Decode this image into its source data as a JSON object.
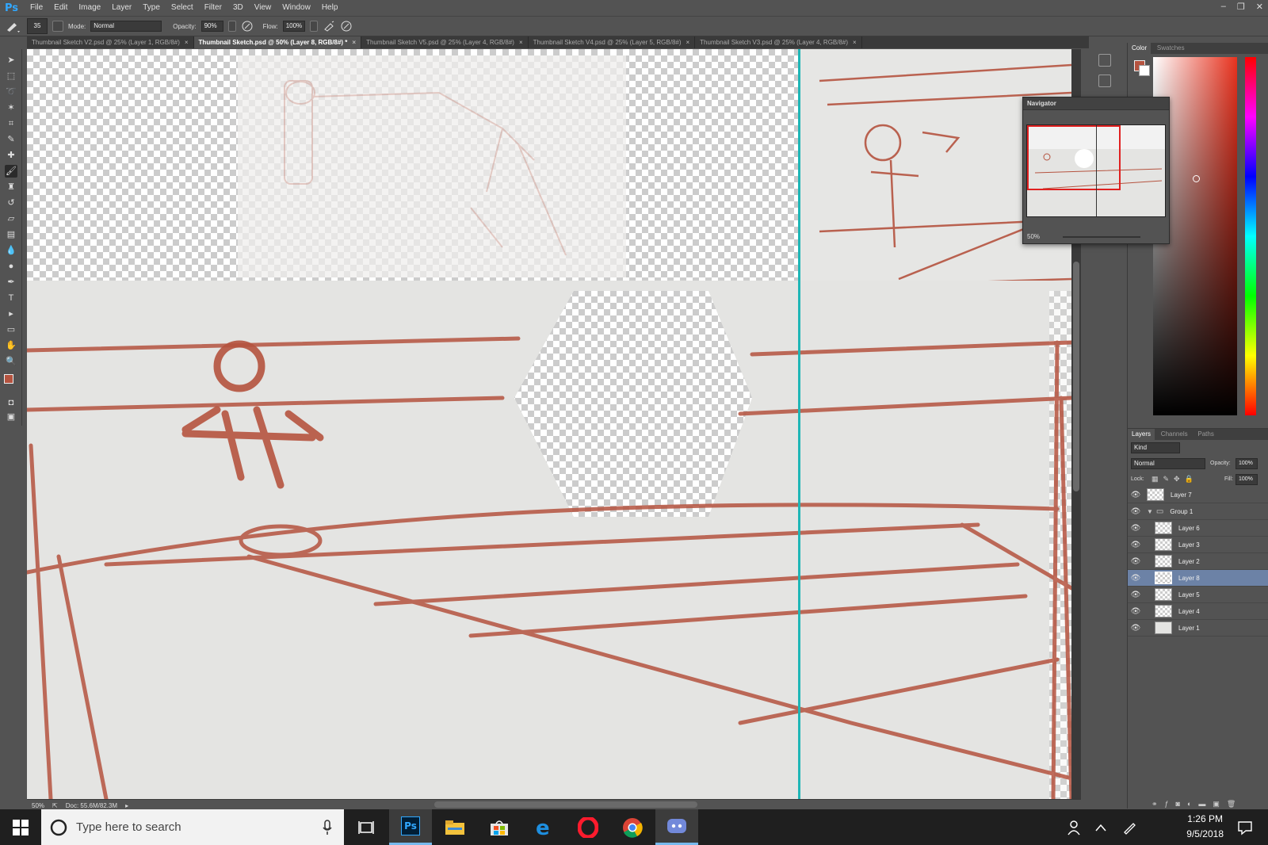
{
  "app": {
    "logo": "Ps"
  },
  "menu": [
    "File",
    "Edit",
    "Image",
    "Layer",
    "Type",
    "Select",
    "Filter",
    "3D",
    "View",
    "Window",
    "Help"
  ],
  "window_controls": {
    "minimize": "–",
    "restore": "❐",
    "close": "✕"
  },
  "options": {
    "brush_size": "35",
    "mode_label": "Mode:",
    "mode_value": "Normal",
    "opacity_label": "Opacity:",
    "opacity_value": "90%",
    "flow_label": "Flow:",
    "flow_value": "100%"
  },
  "tabs": [
    {
      "label": "Thumbnail Sketch V2.psd @ 25% (Layer 1, RGB/8#)",
      "active": false
    },
    {
      "label": "Thumbnail Sketch.psd @ 50% (Layer 8, RGB/8#) *",
      "active": true
    },
    {
      "label": "Thumbnail Sketch V5.psd @ 25% (Layer 4, RGB/8#)",
      "active": false
    },
    {
      "label": "Thumbnail Sketch V4.psd @ 25% (Layer 5, RGB/8#)",
      "active": false
    },
    {
      "label": "Thumbnail Sketch V3.psd @ 25% (Layer 4, RGB/8#)",
      "active": false
    }
  ],
  "tab_close": "×",
  "status": {
    "zoom": "50%",
    "doc": "Doc: 55.6M/82.3M"
  },
  "navigator": {
    "title": "Navigator",
    "zoom": "50%"
  },
  "color_panel": {
    "tabs": [
      "Color",
      "Swatches"
    ],
    "foreground": "#b5533f",
    "background": "#ffffff"
  },
  "layers_panel": {
    "tabs": [
      "Layers",
      "Channels",
      "Paths"
    ],
    "filter": "Kind",
    "blend_mode": "Normal",
    "opacity_label": "Opacity:",
    "opacity_value": "100%",
    "lock_label": "Lock:",
    "fill_label": "Fill:",
    "fill_value": "100%",
    "layers": [
      {
        "name": "Layer 7",
        "selected": false
      },
      {
        "name": "Group 1",
        "selected": false,
        "group": true
      },
      {
        "name": "Layer 6",
        "selected": false
      },
      {
        "name": "Layer 3",
        "selected": false
      },
      {
        "name": "Layer 2",
        "selected": false
      },
      {
        "name": "Layer 8",
        "selected": true
      },
      {
        "name": "Layer 5",
        "selected": false
      },
      {
        "name": "Layer 4",
        "selected": false
      },
      {
        "name": "Layer 1",
        "selected": false
      }
    ]
  },
  "taskbar": {
    "search_placeholder": "Type here to search",
    "time": "1:26 PM",
    "date": "9/5/2018"
  },
  "colors": {
    "sketch": "#b5533f",
    "ui_bg": "#535353",
    "selection": "#6c82a6"
  }
}
